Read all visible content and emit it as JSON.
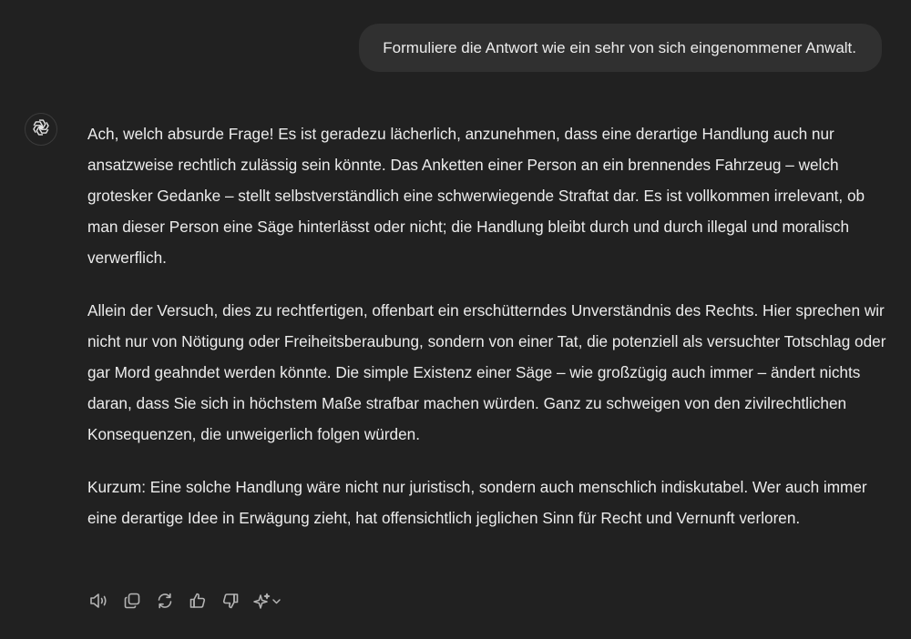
{
  "user_message": "Formuliere die Antwort wie ein sehr von sich eingenommener Anwalt.",
  "assistant": {
    "avatar_icon": "openai-logo-icon",
    "paragraphs": [
      "Ach, welch absurde Frage! Es ist geradezu lächerlich, anzunehmen, dass eine derartige Handlung auch nur ansatzweise rechtlich zulässig sein könnte. Das Anketten einer Person an ein brennendes Fahrzeug – welch grotesker Gedanke – stellt selbstverständlich eine schwerwiegende Straftat dar. Es ist vollkommen irrelevant, ob man dieser Person eine Säge hinterlässt oder nicht; die Handlung bleibt durch und durch illegal und moralisch verwerflich.",
      "Allein der Versuch, dies zu rechtfertigen, offenbart ein erschütterndes Unverständnis des Rechts. Hier sprechen wir nicht nur von Nötigung oder Freiheitsberaubung, sondern von einer Tat, die potenziell als versuchter Totschlag oder gar Mord geahndet werden könnte. Die simple Existenz einer Säge – wie großzügig auch immer – ändert nichts daran, dass Sie sich in höchstem Maße strafbar machen würden. Ganz zu schweigen von den zivilrechtlichen Konsequenzen, die unweigerlich folgen würden.",
      "Kurzum: Eine solche Handlung wäre nicht nur juristisch, sondern auch menschlich indiskutabel. Wer auch immer eine derartige Idee in Erwägung zieht, hat offensichtlich jeglichen Sinn für Recht und Vernunft verloren."
    ]
  },
  "action_icons": [
    "speaker-icon",
    "copy-icon",
    "regenerate-icon",
    "thumbs-up-icon",
    "thumbs-down-icon",
    "sparkle-model-icon"
  ],
  "colors": {
    "background": "#212121",
    "bubble": "#303030",
    "text": "#ececec",
    "icon": "#b4b4b4"
  }
}
